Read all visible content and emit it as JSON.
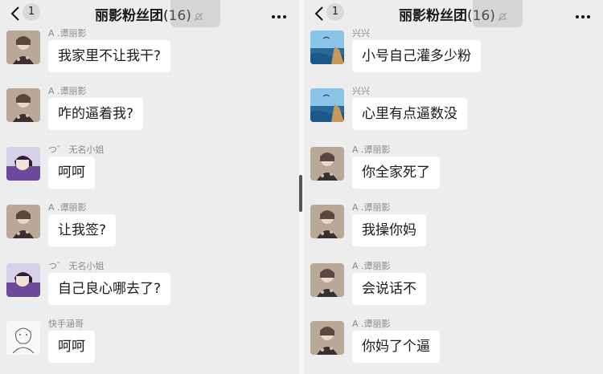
{
  "left_panel": {
    "header": {
      "unread_count": "1",
      "title": "丽影粉丝团",
      "member_count": "(16)"
    },
    "messages": [
      {
        "sender": "A  .谭丽影",
        "text": "我家里不让我干?",
        "avatar": "avatar-woman-patterned"
      },
      {
        "sender": "A  .谭丽影",
        "text": "咋的逼着我?",
        "avatar": "avatar-woman-patterned"
      },
      {
        "sender": "つ゛ 无名小姐",
        "text": "呵呵",
        "avatar": "avatar-girl-purple"
      },
      {
        "sender": "A  .谭丽影",
        "text": "让我签?",
        "avatar": "avatar-woman-patterned"
      },
      {
        "sender": "つ゛ 无名小姐",
        "text": "自己良心哪去了?",
        "avatar": "avatar-girl-purple"
      },
      {
        "sender": "快手涵哥",
        "text": "呵呵",
        "avatar": "avatar-sketch"
      }
    ]
  },
  "right_panel": {
    "header": {
      "unread_count": "1",
      "title": "丽影粉丝团",
      "member_count": "(16)"
    },
    "messages": [
      {
        "sender": "兴兴",
        "text": "小号自己灌多少粉",
        "avatar": "avatar-seascape"
      },
      {
        "sender": "兴兴",
        "text": "心里有点逼数没",
        "avatar": "avatar-seascape"
      },
      {
        "sender": "A  .谭丽影",
        "text": "你全家死了",
        "avatar": "avatar-woman-patterned"
      },
      {
        "sender": "A  .谭丽影",
        "text": "我操你妈",
        "avatar": "avatar-woman-patterned"
      },
      {
        "sender": "A  .谭丽影",
        "text": "会说话不",
        "avatar": "avatar-woman-patterned"
      },
      {
        "sender": "A  .谭丽影",
        "text": "你妈了个逼",
        "avatar": "avatar-woman-patterned"
      }
    ]
  },
  "colors": {
    "background": "#ededed",
    "bubble": "#ffffff",
    "sender_name": "#8a8a8a"
  }
}
